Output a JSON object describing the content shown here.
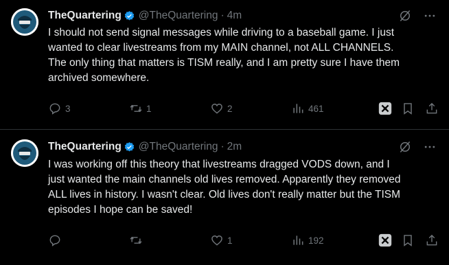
{
  "tweets": [
    {
      "display_name": "TheQuartering",
      "handle": "@TheQuartering",
      "separator": "·",
      "time": "4m",
      "text_lines": [
        "I should not send signal messages while driving to a baseball game.  I just",
        "wanted to clear livestreams from my MAIN channel, not ALL CHANNELS.",
        "The only thing that matters is TISM really, and I am pretty sure I have them",
        "archived somewhere."
      ],
      "replies": "3",
      "reposts": "1",
      "likes": "2",
      "views": "461"
    },
    {
      "display_name": "TheQuartering",
      "handle": "@TheQuartering",
      "separator": "·",
      "time": "2m",
      "text_lines": [
        "I was working off this theory that livestreams dragged VODS down, and I",
        "just wanted the main channels old lives removed.  Apparently they removed",
        "ALL lives in history.  I wasn't clear. Old lives don't really matter but the TISM",
        "episodes I hope can be saved!"
      ],
      "replies": "",
      "reposts": "",
      "likes": "1",
      "views": "192"
    }
  ],
  "colors": {
    "background": "#000000",
    "text": "#e7e9ea",
    "muted": "#71767b",
    "verified_badge": "#1d9bf0",
    "divider": "#2f3336",
    "avatar_accent": "#1f5a7a"
  },
  "icons": [
    "verified-badge-icon",
    "grok-icon",
    "more-icon",
    "reply-icon",
    "repost-icon",
    "like-icon",
    "views-icon",
    "grok-analyze-icon",
    "bookmark-icon",
    "share-icon"
  ]
}
